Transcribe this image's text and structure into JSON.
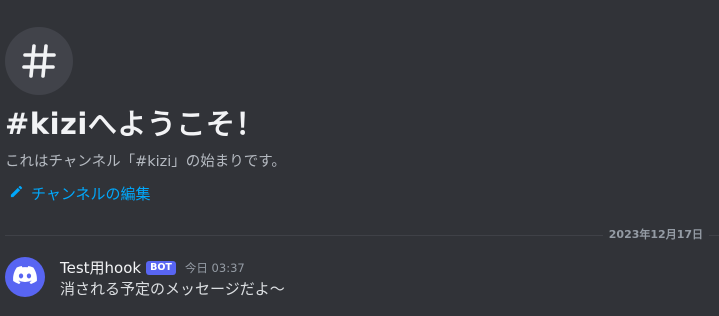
{
  "welcome": {
    "icon": "hash-icon",
    "title": "#kiziへようこそ！",
    "description": "これはチャンネル「#kizi」の始まりです。",
    "edit_link": {
      "icon": "pencil-icon",
      "label": "チャンネルの編集"
    }
  },
  "divider": {
    "date": "2023年12月17日"
  },
  "messages": [
    {
      "avatar_icon": "discord-logo-icon",
      "username": "Test用hook",
      "tag": "BOT",
      "timestamp": "今日 03:37",
      "content": "消される予定のメッセージだよ～"
    }
  ],
  "colors": {
    "background": "#313338",
    "avatar_bg": "#41434a",
    "link": "#00a8fc",
    "bot_tag": "#5865f2",
    "bot_avatar": "#5865f2"
  }
}
